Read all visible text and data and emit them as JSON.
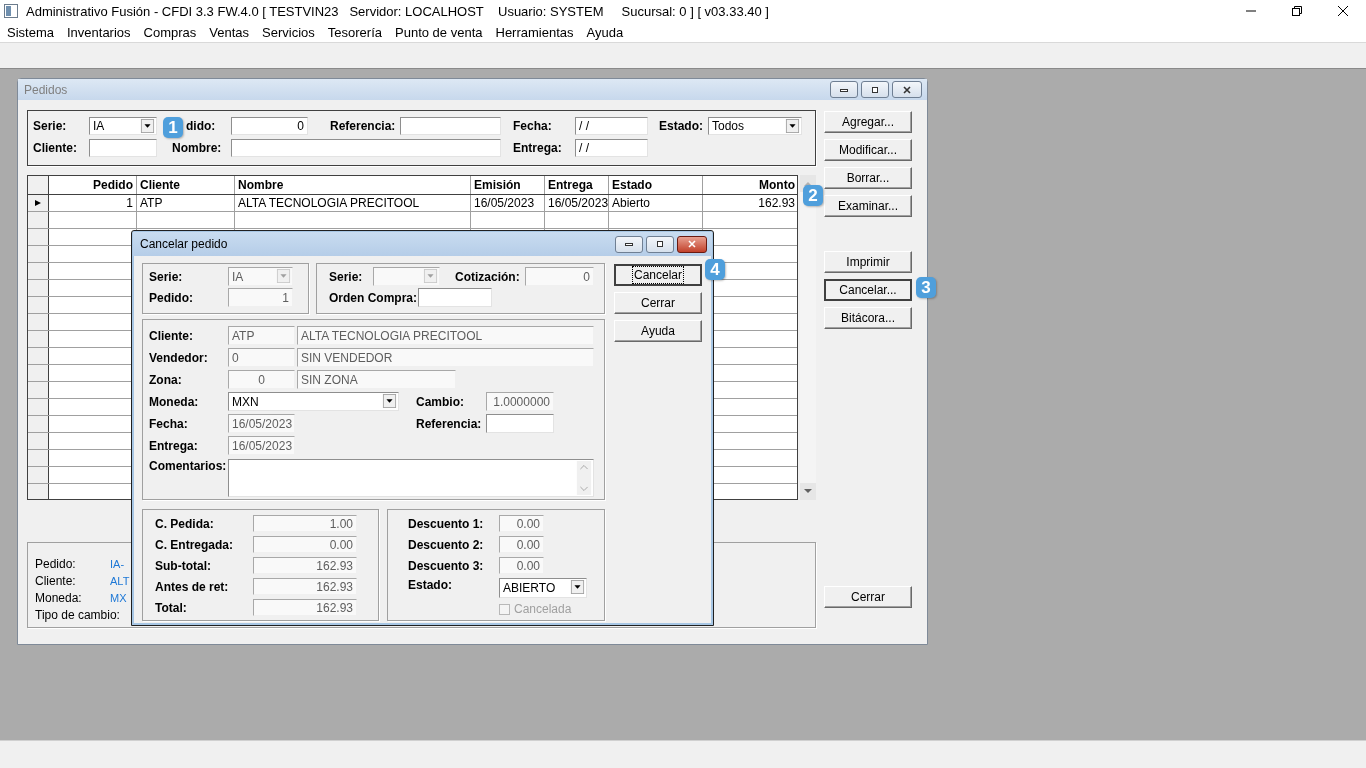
{
  "app_window": {
    "title": "Administrativo Fusión - CFDI 3.3 FW.4.0 [ TESTVIN23   Servidor: LOCALHOST    Usuario: SYSTEM     Sucursal: 0 ] [ v03.33.40 ]"
  },
  "menu": [
    "Sistema",
    "Inventarios",
    "Compras",
    "Ventas",
    "Servicios",
    "Tesorería",
    "Punto de venta",
    "Herramientas",
    "Ayuda"
  ],
  "pedidos_window": {
    "title": "Pedidos",
    "filters": [
      [
        {
          "kind": "label",
          "text": "Serie:"
        },
        {
          "kind": "combo",
          "value": "IA",
          "disabled": false
        },
        {
          "kind": "label",
          "text": "dido:"
        },
        {
          "kind": "text",
          "value": "0",
          "disabled": false
        },
        {
          "kind": "label",
          "text": "Referencia:"
        },
        {
          "kind": "text",
          "disabled": false
        },
        {
          "kind": "label",
          "text": "Fecha:"
        },
        {
          "kind": "text",
          "value": " / /",
          "disabled": false
        },
        {
          "kind": "label",
          "text": "Estado:"
        },
        {
          "kind": "combo",
          "value": "Todos",
          "disabled": false
        }
      ],
      [
        {
          "kind": "label",
          "text": "Cliente:"
        },
        {
          "kind": "text",
          "disabled": false
        },
        {
          "kind": "label",
          "text": "Nombre:"
        },
        {
          "kind": "text",
          "disabled": false
        },
        {
          "kind": "label",
          "text": "Entrega:"
        },
        {
          "kind": "text",
          "value": " / /",
          "disabled": false
        }
      ]
    ],
    "table": {
      "columns": [
        {
          "label": "Pedido"
        },
        {
          "label": "Cliente"
        },
        {
          "label": "Nombre"
        },
        {
          "label": "Emisión"
        },
        {
          "label": "Entrega"
        },
        {
          "label": "Estado"
        },
        {
          "label": "Monto"
        }
      ],
      "rows": [
        {
          "selected": true,
          "cells": [
            "1",
            "ATP",
            "ALTA TECNOLOGIA PRECITOOL",
            "16/05/2023",
            "16/05/2023",
            "Abierto",
            "162.93"
          ]
        }
      ]
    },
    "buttons": [
      {
        "label": "Agregar...",
        "focused": false
      },
      {
        "label": "Modificar...",
        "focused": false
      },
      {
        "label": "Borrar...",
        "focused": false
      },
      {
        "label": "Examinar...",
        "focused": false
      },
      {
        "label": "Imprimir",
        "focused": false
      },
      {
        "label": "Cancelar...",
        "focused": true
      },
      {
        "label": "Bitácora...",
        "focused": false
      },
      {
        "label": "Cerrar",
        "focused": false
      }
    ],
    "summary": [
      {
        "label": "Pedido:",
        "value": "IA-"
      },
      {
        "label": "Cliente:",
        "value": "ALT"
      },
      {
        "label": "Moneda:",
        "value": "MX"
      },
      {
        "label": "Tipo de cambio:"
      }
    ]
  },
  "cancel_dialog": {
    "title": "Cancelar pedido",
    "serie_group": [
      [
        {
          "kind": "label",
          "text": "Serie:"
        },
        {
          "kind": "combo",
          "value": "IA",
          "disabled": true
        }
      ],
      [
        {
          "kind": "label",
          "text": "Pedido:"
        },
        {
          "kind": "text",
          "value": "1",
          "disabled": true
        }
      ]
    ],
    "quote_group": [
      [
        {
          "kind": "label",
          "text": "Serie:"
        },
        {
          "kind": "combo",
          "disabled": true
        },
        {
          "kind": "label",
          "text": "Cotización:"
        },
        {
          "kind": "text",
          "value": "0",
          "disabled": true
        }
      ],
      [
        {
          "kind": "label",
          "text": "Orden Compra:"
        },
        {
          "kind": "text",
          "disabled": false
        }
      ]
    ],
    "details": [
      [
        {
          "kind": "label",
          "text": "Cliente:"
        },
        {
          "kind": "text",
          "value": "ATP",
          "disabled": true
        },
        {
          "kind": "text",
          "value": "ALTA TECNOLOGIA PRECITOOL",
          "disabled": true
        }
      ],
      [
        {
          "kind": "label",
          "text": "Vendedor:"
        },
        {
          "kind": "text",
          "value": "0",
          "disabled": true
        },
        {
          "kind": "text",
          "value": "SIN VENDEDOR",
          "disabled": true
        }
      ],
      [
        {
          "kind": "label",
          "text": "Zona:"
        },
        {
          "kind": "text",
          "value": "0",
          "disabled": true
        },
        {
          "kind": "text",
          "value": "SIN ZONA",
          "disabled": true
        }
      ],
      [
        {
          "kind": "label",
          "text": "Moneda:"
        },
        {
          "kind": "combo",
          "value": "MXN",
          "disabled": false
        },
        {
          "kind": "label",
          "text": "Cambio:"
        },
        {
          "kind": "text",
          "value": "1.0000000",
          "disabled": true
        }
      ],
      [
        {
          "kind": "label",
          "text": "Fecha:"
        },
        {
          "kind": "text",
          "value": "16/05/2023",
          "disabled": true
        },
        {
          "kind": "label",
          "text": "Referencia:"
        },
        {
          "kind": "text",
          "disabled": false
        }
      ],
      [
        {
          "kind": "label",
          "text": "Entrega:"
        },
        {
          "kind": "text",
          "value": "16/05/2023",
          "disabled": true
        }
      ],
      [
        {
          "kind": "label",
          "text": "Comentarios:"
        },
        {
          "kind": "memo",
          "disabled": false
        }
      ]
    ],
    "totals": [
      [
        {
          "kind": "label",
          "text": "C. Pedida:"
        },
        {
          "kind": "text",
          "value": "1.00",
          "disabled": true
        }
      ],
      [
        {
          "kind": "label",
          "text": "C. Entregada:"
        },
        {
          "kind": "text",
          "value": "0.00",
          "disabled": true
        }
      ],
      [
        {
          "kind": "label",
          "text": "Sub-total:"
        },
        {
          "kind": "text",
          "value": "162.93",
          "disabled": true
        }
      ],
      [
        {
          "kind": "label",
          "text": "Antes de ret:"
        },
        {
          "kind": "text",
          "value": "162.93",
          "disabled": true
        }
      ],
      [
        {
          "kind": "label",
          "text": "Total:"
        },
        {
          "kind": "text",
          "value": "162.93",
          "disabled": true
        }
      ]
    ],
    "discounts": [
      [
        {
          "kind": "label",
          "text": "Descuento 1:"
        },
        {
          "kind": "text",
          "value": "0.00",
          "disabled": true
        }
      ],
      [
        {
          "kind": "label",
          "text": "Descuento 2:"
        },
        {
          "kind": "text",
          "value": "0.00",
          "disabled": true
        }
      ],
      [
        {
          "kind": "label",
          "text": "Descuento 3:"
        },
        {
          "kind": "text",
          "value": "0.00",
          "disabled": true
        }
      ],
      [
        {
          "kind": "label",
          "text": "Estado:"
        },
        {
          "kind": "combo",
          "value": "ABIERTO",
          "disabled": false
        }
      ],
      [
        {
          "kind": "check",
          "label": "Cancelada",
          "checked": false,
          "disabled": true
        }
      ]
    ],
    "buttons": [
      {
        "label": "Cancelar",
        "focused": true
      },
      {
        "label": "Cerrar",
        "focused": false
      },
      {
        "label": "Ayuda",
        "focused": false
      }
    ]
  },
  "markers": [
    {
      "label": "1"
    },
    {
      "label": "2"
    },
    {
      "label": "3"
    },
    {
      "label": "4"
    }
  ]
}
